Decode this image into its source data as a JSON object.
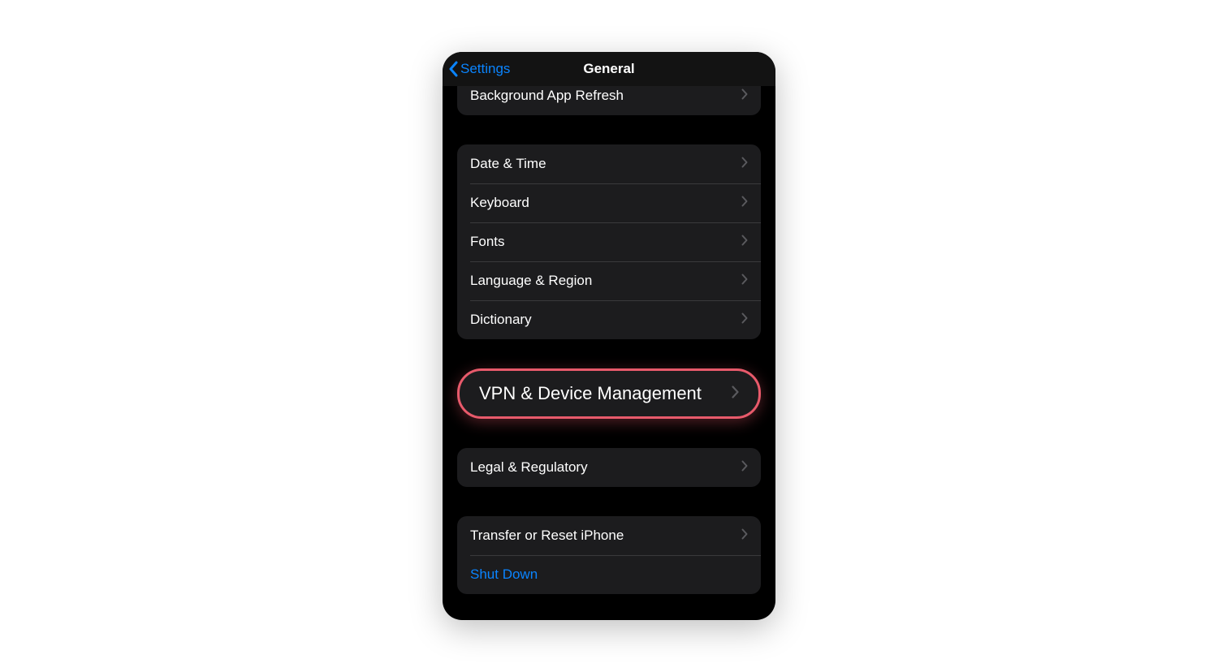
{
  "nav": {
    "back_label": "Settings",
    "title": "General"
  },
  "group_top": {
    "items": [
      {
        "label": "Background App Refresh"
      }
    ]
  },
  "group_locale": {
    "items": [
      {
        "label": "Date & Time"
      },
      {
        "label": "Keyboard"
      },
      {
        "label": "Fonts"
      },
      {
        "label": "Language & Region"
      },
      {
        "label": "Dictionary"
      }
    ]
  },
  "group_vpn": {
    "label": "VPN & Device Management"
  },
  "group_legal": {
    "items": [
      {
        "label": "Legal & Regulatory"
      }
    ]
  },
  "group_reset": {
    "items": [
      {
        "label": "Transfer or Reset iPhone"
      },
      {
        "label": "Shut Down",
        "link": true
      }
    ]
  },
  "colors": {
    "accent": "#0a84ff",
    "highlight_border": "#e85a6b",
    "cell_bg": "#1c1c1e",
    "chevron": "#5a5a5e"
  }
}
